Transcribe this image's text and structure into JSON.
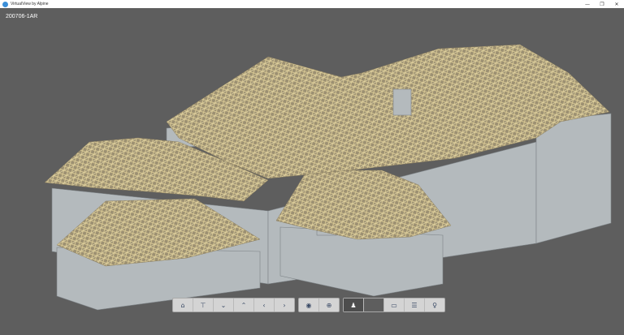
{
  "window": {
    "title": "VirtualView by Alpine",
    "minimize": "—",
    "restore": "❐",
    "close": "✕"
  },
  "viewport": {
    "project_label": "200706-1AR"
  },
  "colors": {
    "background": "#5e5e5e",
    "wall": "#b4babd",
    "truss": "#cbb88a",
    "accent": "#3b8fd9"
  },
  "toolbar": {
    "groups": [
      [
        {
          "icon": "home-icon",
          "glyph": "⌂"
        },
        {
          "icon": "top-view-icon",
          "glyph": "⊤"
        },
        {
          "icon": "chevron-down-icon",
          "glyph": "⌄"
        },
        {
          "icon": "chevron-up-icon",
          "glyph": "⌃"
        },
        {
          "icon": "chevron-left-icon",
          "glyph": "‹"
        },
        {
          "icon": "chevron-right-icon",
          "glyph": "›"
        }
      ],
      [
        {
          "icon": "eye-icon",
          "glyph": "◉"
        },
        {
          "icon": "zoom-icon",
          "glyph": "⊕"
        }
      ],
      [
        {
          "icon": "person-icon",
          "glyph": "♟"
        },
        {
          "icon": "blank",
          "glyph": ""
        },
        {
          "icon": "ruler-icon",
          "glyph": "▭"
        },
        {
          "icon": "section-icon",
          "glyph": "☰"
        },
        {
          "icon": "walk-icon",
          "glyph": "♀"
        }
      ]
    ]
  }
}
